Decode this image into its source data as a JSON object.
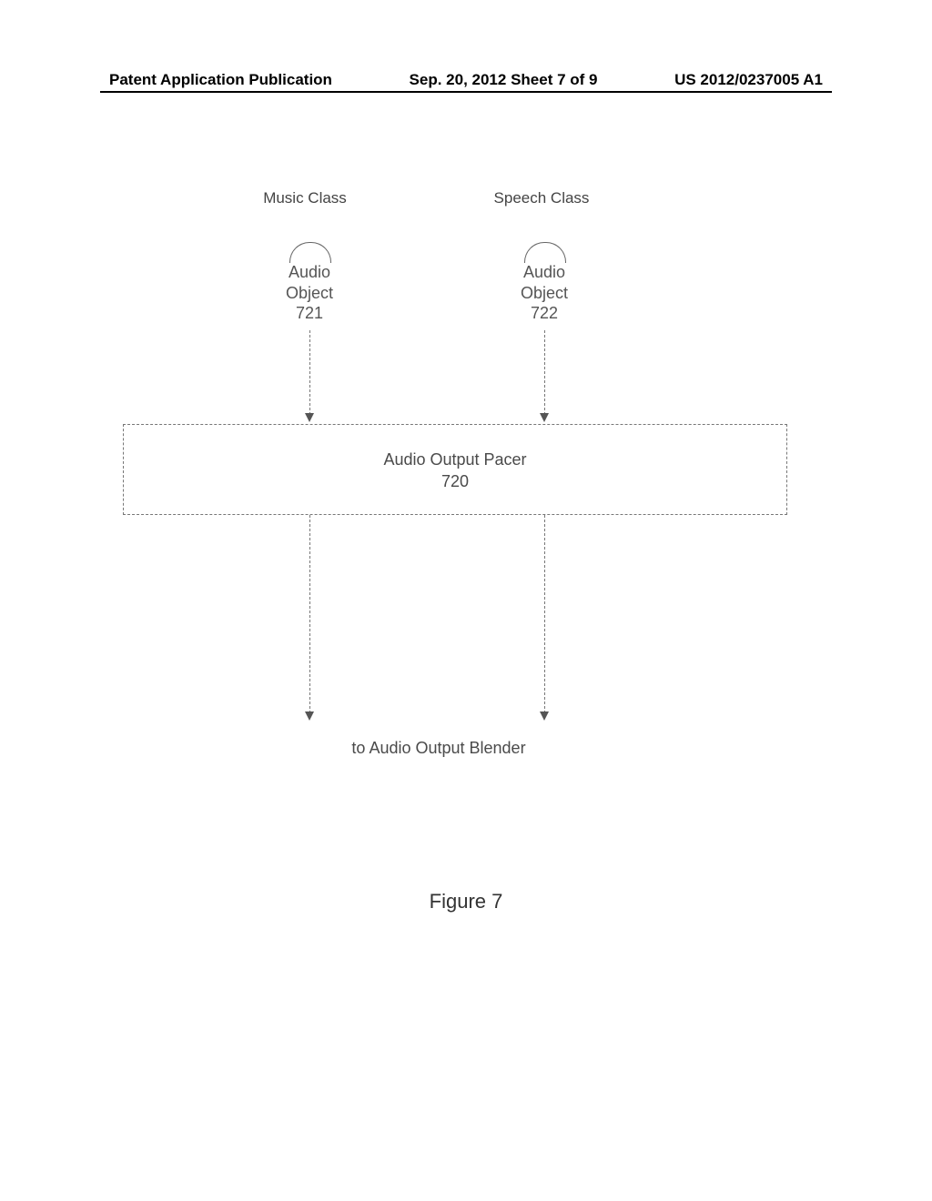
{
  "header": {
    "left": "Patent Application Publication",
    "center": "Sep. 20, 2012  Sheet 7 of 9",
    "right": "US 2012/0237005 A1"
  },
  "labels": {
    "music_class": "Music Class",
    "speech_class": "Speech Class",
    "blender": "to Audio Output Blender",
    "figure": "Figure 7"
  },
  "objects": {
    "obj721": {
      "line1": "Audio",
      "line2": "Object",
      "num": "721"
    },
    "obj722": {
      "line1": "Audio",
      "line2": "Object",
      "num": "722"
    }
  },
  "pacer": {
    "title": "Audio Output Pacer",
    "num": "720"
  }
}
